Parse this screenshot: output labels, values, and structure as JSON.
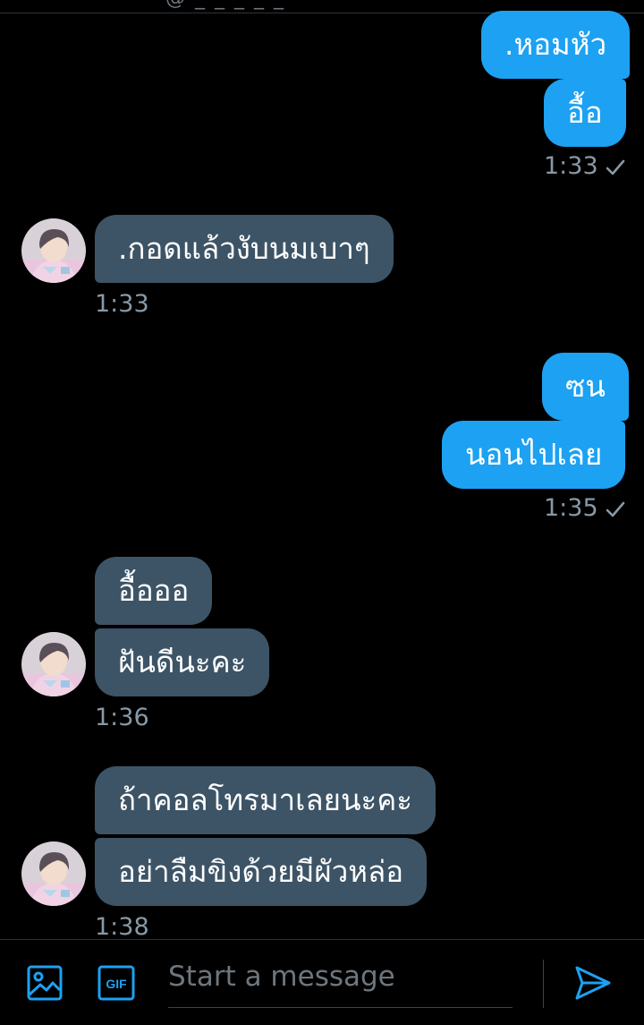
{
  "header": {
    "handle_partial": "@ _ _ _ _ _"
  },
  "messages": [
    {
      "side": "sent",
      "text": ".หอมหัว"
    },
    {
      "side": "sent",
      "text": "อื้อ"
    },
    {
      "side": "sent",
      "time": "1:33"
    },
    {
      "side": "recv",
      "text": ".กอดแล้วงับนมเบาๆ"
    },
    {
      "side": "recv",
      "time": "1:33"
    },
    {
      "side": "sent",
      "text": "ซน"
    },
    {
      "side": "sent",
      "text": "นอนไปเลย"
    },
    {
      "side": "sent",
      "time": "1:35"
    },
    {
      "side": "recv",
      "text": "อื้อออ"
    },
    {
      "side": "recv",
      "text": "ฝันดีนะคะ"
    },
    {
      "side": "recv",
      "time": "1:36"
    },
    {
      "side": "recv",
      "text": "ถ้าคอลโทรมาเลยนะคะ"
    },
    {
      "side": "recv",
      "text": "อย่าลืมขิงด้วยมีผัวหล่อ"
    },
    {
      "side": "recv",
      "time": "1:38"
    }
  ],
  "composer": {
    "placeholder": "Start a message",
    "gif_label": "GIF",
    "icons": [
      "image-icon",
      "gif-icon",
      "send-icon"
    ]
  },
  "colors": {
    "background": "#000000",
    "sent_bubble": "#1da1f2",
    "received_bubble": "#3d5466",
    "accent": "#1da1f2",
    "timestamp": "#8899a6"
  }
}
